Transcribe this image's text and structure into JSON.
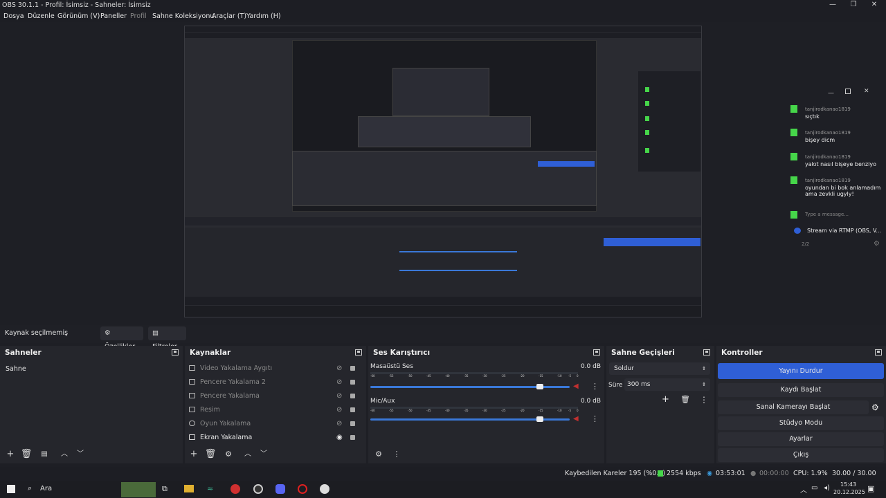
{
  "window": {
    "title": "OBS 30.1.1 - Profil: İsimsiz - Sahneler: İsimsiz"
  },
  "menu": [
    "Dosya",
    "Düzenle",
    "Görünüm (V)",
    "Paneller",
    "Profil",
    "Sahne Koleksiyonu",
    "Araçlar (T)",
    "Yardım (H)"
  ],
  "source_bar": {
    "status": "Kaynak seçilmemiş",
    "properties": "Özellikler",
    "filters": "Filtreler"
  },
  "scenes": {
    "title": "Sahneler",
    "items": [
      "Sahne"
    ]
  },
  "sources": {
    "title": "Kaynaklar",
    "items": [
      {
        "label": "Video Yakalama Aygıtı",
        "icon": "camera-icon",
        "visible": false
      },
      {
        "label": "Pencere Yakalama 2",
        "icon": "window-icon",
        "visible": false
      },
      {
        "label": "Pencere Yakalama",
        "icon": "window-icon",
        "visible": false
      },
      {
        "label": "Resim",
        "icon": "image-icon",
        "visible": false
      },
      {
        "label": "Oyun Yakalama",
        "icon": "gamepad-icon",
        "visible": false
      },
      {
        "label": "Ekran Yakalama",
        "icon": "monitor-icon",
        "visible": true
      }
    ]
  },
  "mixer": {
    "title": "Ses Karıştırıcı",
    "ticks": [
      "-60",
      "-55",
      "-50",
      "-45",
      "-40",
      "-35",
      "-30",
      "-25",
      "-20",
      "-15",
      "-10",
      "-5",
      "0"
    ],
    "channels": [
      {
        "name": "Masaüstü Ses",
        "db": "0.0 dB",
        "volume": 0.85
      },
      {
        "name": "Mic/Aux",
        "db": "0.0 dB",
        "volume": 0.85
      }
    ]
  },
  "transitions": {
    "title": "Sahne Geçişleri",
    "type": "Soldur",
    "duration_label": "Süre",
    "duration": "300 ms"
  },
  "controls": {
    "title": "Kontroller",
    "buttons": [
      "Yayını Durdur",
      "Kaydı Başlat",
      "Sanal Kamerayı Başlat",
      "Stüdyo Modu",
      "Ayarlar",
      "Çıkış"
    ]
  },
  "status": {
    "dropped": "Kaybedilen Kareler 195 (%0.0)",
    "bitrate": "2554 kbps",
    "stream_time": "03:53:01",
    "rec_time": "00:00:00",
    "cpu": "CPU: 1.9%",
    "fps": "30.00 / 30.00 FPS"
  },
  "taskbar": {
    "search": "Ara",
    "time": "15:43",
    "date": "20.12.2025"
  },
  "chat": {
    "messages": [
      {
        "user": "tanjirodkanao1819",
        "text": "sıçtık"
      },
      {
        "user": "tanjirodkanao1819",
        "text": "bişey dicm"
      },
      {
        "user": "tanjirodkanao1819",
        "text": "yakıt nasıl bişeye benziyo"
      },
      {
        "user": "tanjirodkanao1819",
        "text": "oyundan bi bok anlamadım ama zevkli ugyly!"
      }
    ],
    "placeholder": "Type a message...",
    "stream_label": "Stream via RTMP (OBS, V...",
    "count": "2/2"
  },
  "colors": {
    "accent": "#2f5fd6",
    "kick": "#46d64a",
    "bg": "#1e1f25",
    "dock": "#25262c"
  }
}
